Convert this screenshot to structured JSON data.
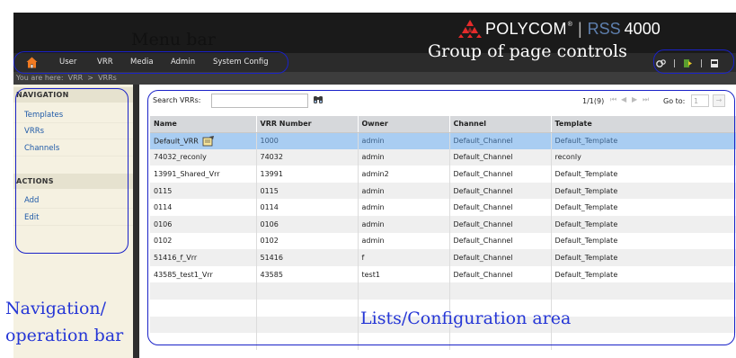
{
  "header": {
    "brand_name": "POLYCOM",
    "brand_registered": "®",
    "separator": "|",
    "product": "RSS",
    "model": "4000",
    "logo_color": "#e52b2b"
  },
  "menu": {
    "items": [
      {
        "label": "User"
      },
      {
        "label": "VRR"
      },
      {
        "label": "Media"
      },
      {
        "label": "Admin"
      },
      {
        "label": "System Config"
      }
    ]
  },
  "breadcrumb": "You are here:  VRR  >  VRRs",
  "page_controls": {
    "separator": "|"
  },
  "sidebar": {
    "navigation_title": "NAVIGATION",
    "navigation_items": [
      {
        "label": "Templates"
      },
      {
        "label": "VRRs"
      },
      {
        "label": "Channels"
      }
    ],
    "actions_title": "ACTIONS",
    "action_items": [
      {
        "label": "Add"
      },
      {
        "label": "Edit"
      }
    ]
  },
  "search": {
    "label": "Search VRRs:",
    "value": ""
  },
  "pager": {
    "text": "1/1(9)",
    "first": "⏮",
    "prev": "◀",
    "next": "▶",
    "last": "⏭",
    "goto_label": "Go to:",
    "goto_value": "1",
    "goto_button": "→"
  },
  "table": {
    "columns": [
      "Name",
      "VRR Number",
      "Owner",
      "Channel",
      "Template"
    ],
    "rows": [
      {
        "name": "Default_VRR",
        "number": "1000",
        "owner": "admin",
        "channel": "Default_Channel",
        "template": "Default_Template"
      },
      {
        "name": "74032_reconly",
        "number": "74032",
        "owner": "admin",
        "channel": "Default_Channel",
        "template": "reconly"
      },
      {
        "name": "13991_Shared_Vrr",
        "number": "13991",
        "owner": "admin2",
        "channel": "Default_Channel",
        "template": "Default_Template"
      },
      {
        "name": "0115",
        "number": "0115",
        "owner": "admin",
        "channel": "Default_Channel",
        "template": "Default_Template"
      },
      {
        "name": "0114",
        "number": "0114",
        "owner": "admin",
        "channel": "Default_Channel",
        "template": "Default_Template"
      },
      {
        "name": "0106",
        "number": "0106",
        "owner": "admin",
        "channel": "Default_Channel",
        "template": "Default_Template"
      },
      {
        "name": "0102",
        "number": "0102",
        "owner": "admin",
        "channel": "Default_Channel",
        "template": "Default_Template"
      },
      {
        "name": "51416_f_Vrr",
        "number": "51416",
        "owner": "f",
        "channel": "Default_Channel",
        "template": "Default_Template"
      },
      {
        "name": "43585_test1_Vrr",
        "number": "43585",
        "owner": "test1",
        "channel": "Default_Channel",
        "template": "Default_Template"
      }
    ]
  },
  "annotations": {
    "menu_bar": "Menu bar",
    "page_controls": "Group of page controls",
    "navigation": "Navigation/\noperation bar",
    "lists": "Lists/Configuration area",
    "color": "#2536d6"
  }
}
